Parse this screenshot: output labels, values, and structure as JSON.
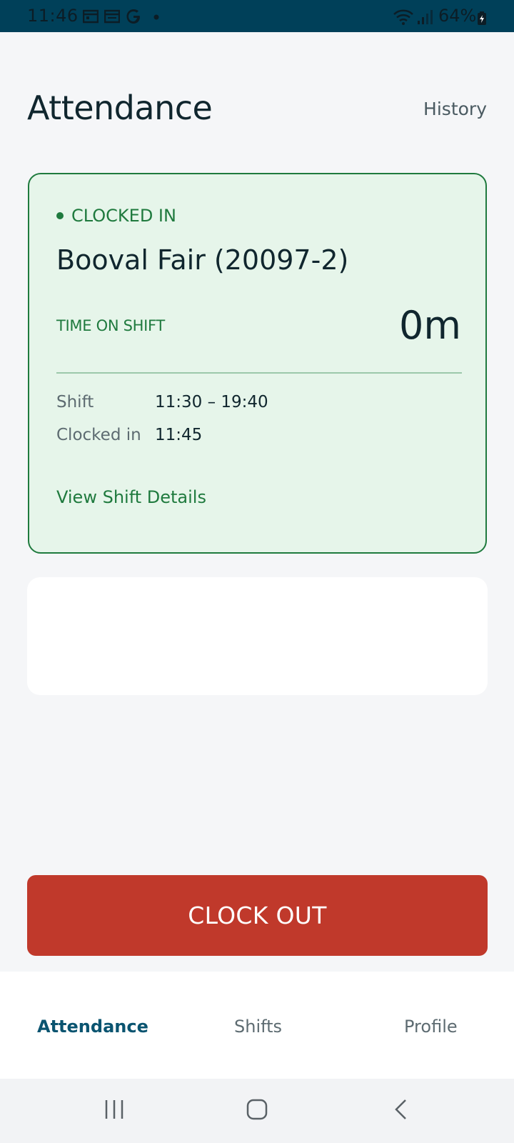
{
  "status_bar": {
    "time": "11:46",
    "notification_icons": [
      "calendar-icon",
      "calendar-icon",
      "google-icon",
      "dot-icon"
    ],
    "system_icons": [
      "wifi-icon",
      "signal-icon"
    ],
    "battery": "64%"
  },
  "header": {
    "title": "Attendance",
    "history_label": "History"
  },
  "shift_card": {
    "status": "CLOCKED IN",
    "location": "Booval Fair (20097-2)",
    "time_on_shift_label": "TIME ON SHIFT",
    "time_on_shift_value": "0m",
    "shift_label": "Shift",
    "shift_value": "11:30 – 19:40",
    "clocked_in_label": "Clocked in",
    "clocked_in_value": "11:45",
    "view_details_label": "View Shift Details"
  },
  "clock_out_label": "CLOCK OUT",
  "tabs": [
    {
      "label": "Attendance",
      "active": true
    },
    {
      "label": "Shifts",
      "active": false
    },
    {
      "label": "Profile",
      "active": false
    }
  ],
  "nav_icons": [
    "recent-apps-icon",
    "home-icon",
    "back-icon"
  ],
  "colors": {
    "status_bar": "#004059",
    "accent_green": "#1f7a3e",
    "card_bg": "#e6f5ea",
    "clock_out": "#c0392b",
    "active_tab": "#0a5470"
  }
}
